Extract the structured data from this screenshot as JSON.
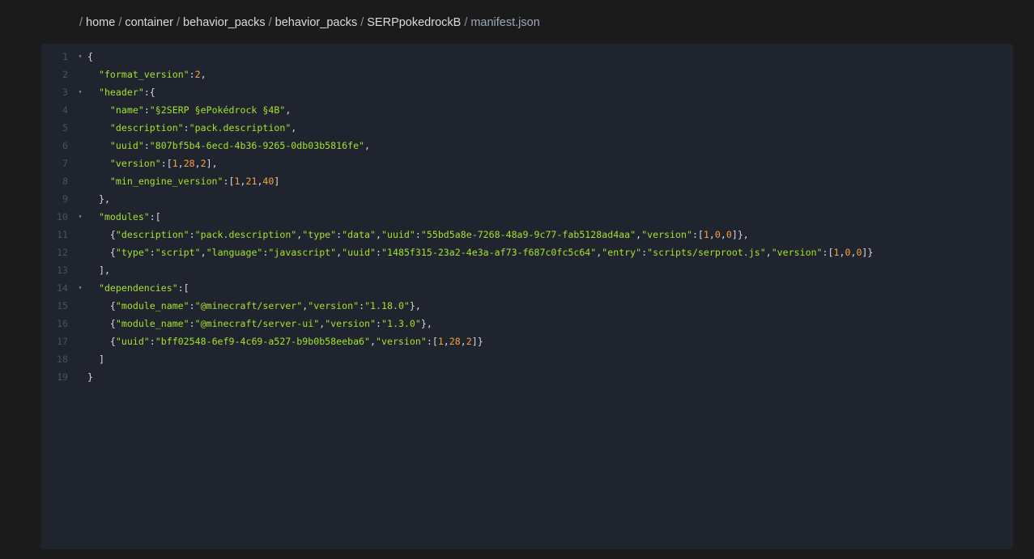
{
  "breadcrumb": {
    "items": [
      "home",
      "container",
      "behavior_packs",
      "behavior_packs",
      "SERPpokedrockB"
    ],
    "current": "manifest.json",
    "separator": "/"
  },
  "editor": {
    "colors": {
      "background": "#20242e",
      "string": "#a6e22e",
      "number": "#f5a442",
      "line_number": "#4b5160"
    },
    "lines": [
      {
        "n": "1",
        "fold": true,
        "tokens": [
          [
            "p",
            "{"
          ]
        ]
      },
      {
        "n": "2",
        "fold": false,
        "tokens": [
          [
            "p",
            "  "
          ],
          [
            "s",
            "\"format_version\""
          ],
          [
            "p",
            ":"
          ],
          [
            "n",
            "2"
          ],
          [
            "p",
            ","
          ]
        ]
      },
      {
        "n": "3",
        "fold": true,
        "tokens": [
          [
            "p",
            "  "
          ],
          [
            "s",
            "\"header\""
          ],
          [
            "p",
            ":{"
          ]
        ]
      },
      {
        "n": "4",
        "fold": false,
        "tokens": [
          [
            "p",
            "    "
          ],
          [
            "s",
            "\"name\""
          ],
          [
            "p",
            ":"
          ],
          [
            "s",
            "\"§2SERP §ePokédrock §4B\""
          ],
          [
            "p",
            ","
          ]
        ]
      },
      {
        "n": "5",
        "fold": false,
        "tokens": [
          [
            "p",
            "    "
          ],
          [
            "s",
            "\"description\""
          ],
          [
            "p",
            ":"
          ],
          [
            "s",
            "\"pack.description\""
          ],
          [
            "p",
            ","
          ]
        ]
      },
      {
        "n": "6",
        "fold": false,
        "tokens": [
          [
            "p",
            "    "
          ],
          [
            "s",
            "\"uuid\""
          ],
          [
            "p",
            ":"
          ],
          [
            "s",
            "\"807bf5b4-6ecd-4b36-9265-0db03b5816fe\""
          ],
          [
            "p",
            ","
          ]
        ]
      },
      {
        "n": "7",
        "fold": false,
        "tokens": [
          [
            "p",
            "    "
          ],
          [
            "s",
            "\"version\""
          ],
          [
            "p",
            ":["
          ],
          [
            "n",
            "1"
          ],
          [
            "p",
            ","
          ],
          [
            "n",
            "28"
          ],
          [
            "p",
            ","
          ],
          [
            "n",
            "2"
          ],
          [
            "p",
            "],"
          ]
        ]
      },
      {
        "n": "8",
        "fold": false,
        "tokens": [
          [
            "p",
            "    "
          ],
          [
            "s",
            "\"min_engine_version\""
          ],
          [
            "p",
            ":["
          ],
          [
            "n",
            "1"
          ],
          [
            "p",
            ","
          ],
          [
            "n",
            "21"
          ],
          [
            "p",
            ","
          ],
          [
            "n",
            "40"
          ],
          [
            "p",
            "]"
          ]
        ]
      },
      {
        "n": "9",
        "fold": false,
        "tokens": [
          [
            "p",
            "  },"
          ]
        ]
      },
      {
        "n": "10",
        "fold": true,
        "tokens": [
          [
            "p",
            "  "
          ],
          [
            "s",
            "\"modules\""
          ],
          [
            "p",
            ":["
          ]
        ]
      },
      {
        "n": "11",
        "fold": false,
        "tokens": [
          [
            "p",
            "    {"
          ],
          [
            "s",
            "\"description\""
          ],
          [
            "p",
            ":"
          ],
          [
            "s",
            "\"pack.description\""
          ],
          [
            "p",
            ","
          ],
          [
            "s",
            "\"type\""
          ],
          [
            "p",
            ":"
          ],
          [
            "s",
            "\"data\""
          ],
          [
            "p",
            ","
          ],
          [
            "s",
            "\"uuid\""
          ],
          [
            "p",
            ":"
          ],
          [
            "s",
            "\"55bd5a8e-7268-48a9-9c77-fab5128ad4aa\""
          ],
          [
            "p",
            ","
          ],
          [
            "s",
            "\"version\""
          ],
          [
            "p",
            ":["
          ],
          [
            "n",
            "1"
          ],
          [
            "p",
            ","
          ],
          [
            "n",
            "0"
          ],
          [
            "p",
            ","
          ],
          [
            "n",
            "0"
          ],
          [
            "p",
            "]},"
          ]
        ]
      },
      {
        "n": "12",
        "fold": false,
        "tokens": [
          [
            "p",
            "    {"
          ],
          [
            "s",
            "\"type\""
          ],
          [
            "p",
            ":"
          ],
          [
            "s",
            "\"script\""
          ],
          [
            "p",
            ","
          ],
          [
            "s",
            "\"language\""
          ],
          [
            "p",
            ":"
          ],
          [
            "s",
            "\"javascript\""
          ],
          [
            "p",
            ","
          ],
          [
            "s",
            "\"uuid\""
          ],
          [
            "p",
            ":"
          ],
          [
            "s",
            "\"1485f315-23a2-4e3a-af73-f687c0fc5c64\""
          ],
          [
            "p",
            ","
          ],
          [
            "s",
            "\"entry\""
          ],
          [
            "p",
            ":"
          ],
          [
            "s",
            "\"scripts/serproot.js\""
          ],
          [
            "p",
            ","
          ],
          [
            "s",
            "\"version\""
          ],
          [
            "p",
            ":["
          ],
          [
            "n",
            "1"
          ],
          [
            "p",
            ","
          ],
          [
            "n",
            "0"
          ],
          [
            "p",
            ","
          ],
          [
            "n",
            "0"
          ],
          [
            "p",
            "]}"
          ]
        ]
      },
      {
        "n": "13",
        "fold": false,
        "tokens": [
          [
            "p",
            "  ],"
          ]
        ]
      },
      {
        "n": "14",
        "fold": true,
        "tokens": [
          [
            "p",
            "  "
          ],
          [
            "s",
            "\"dependencies\""
          ],
          [
            "p",
            ":["
          ]
        ]
      },
      {
        "n": "15",
        "fold": false,
        "tokens": [
          [
            "p",
            "    {"
          ],
          [
            "s",
            "\"module_name\""
          ],
          [
            "p",
            ":"
          ],
          [
            "s",
            "\"@minecraft/server\""
          ],
          [
            "p",
            ","
          ],
          [
            "s",
            "\"version\""
          ],
          [
            "p",
            ":"
          ],
          [
            "s",
            "\"1.18.0\""
          ],
          [
            "p",
            "},"
          ]
        ]
      },
      {
        "n": "16",
        "fold": false,
        "tokens": [
          [
            "p",
            "    {"
          ],
          [
            "s",
            "\"module_name\""
          ],
          [
            "p",
            ":"
          ],
          [
            "s",
            "\"@minecraft/server-ui\""
          ],
          [
            "p",
            ","
          ],
          [
            "s",
            "\"version\""
          ],
          [
            "p",
            ":"
          ],
          [
            "s",
            "\"1.3.0\""
          ],
          [
            "p",
            "},"
          ]
        ]
      },
      {
        "n": "17",
        "fold": false,
        "tokens": [
          [
            "p",
            "    {"
          ],
          [
            "s",
            "\"uuid\""
          ],
          [
            "p",
            ":"
          ],
          [
            "s",
            "\"bff02548-6ef9-4c69-a527-b9b0b58eeba6\""
          ],
          [
            "p",
            ","
          ],
          [
            "s",
            "\"version\""
          ],
          [
            "p",
            ":["
          ],
          [
            "n",
            "1"
          ],
          [
            "p",
            ","
          ],
          [
            "n",
            "28"
          ],
          [
            "p",
            ","
          ],
          [
            "n",
            "2"
          ],
          [
            "p",
            "]}"
          ]
        ]
      },
      {
        "n": "18",
        "fold": false,
        "tokens": [
          [
            "p",
            "  ]"
          ]
        ]
      },
      {
        "n": "19",
        "fold": false,
        "tokens": [
          [
            "p",
            "}"
          ]
        ]
      }
    ]
  }
}
